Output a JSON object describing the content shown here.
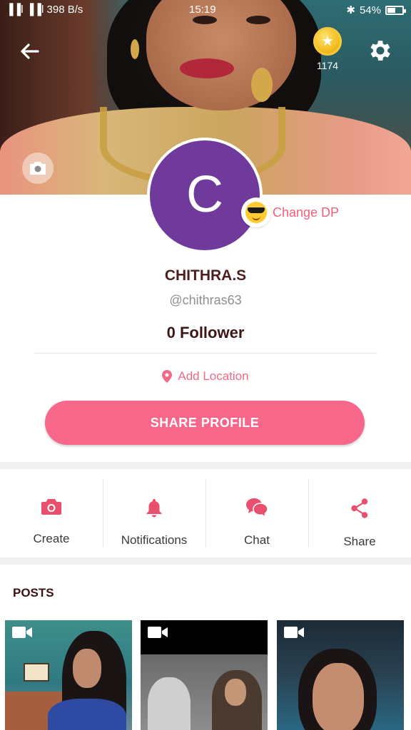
{
  "status_bar": {
    "signal": "▐▐l ▐▐l",
    "network_speed": "398 B/s",
    "time": "15:19",
    "battery_percent": "54%"
  },
  "header": {
    "coin_count": "1174"
  },
  "profile": {
    "avatar_letter": "C",
    "change_dp_label": "Change DP",
    "name": "CHITHRA.S",
    "username": "@chithras63",
    "followers": "0 Follower",
    "add_location_label": "Add Location",
    "share_button_label": "SHARE PROFILE"
  },
  "actions": [
    {
      "label": "Create",
      "icon": "camera-icon"
    },
    {
      "label": "Notifications",
      "icon": "bell-icon"
    },
    {
      "label": "Chat",
      "icon": "chat-bubbles-icon"
    },
    {
      "label": "Share",
      "icon": "share-icon"
    }
  ],
  "posts": {
    "title": "POSTS",
    "items": [
      {
        "type": "video",
        "icon": "video-camera-icon"
      },
      {
        "type": "video",
        "icon": "video-camera-icon"
      },
      {
        "type": "video",
        "icon": "video-camera-icon"
      }
    ]
  },
  "colors": {
    "accent": "#f7678a",
    "avatar_bg": "#6f3a9b",
    "name_text": "#4d1e1e"
  }
}
